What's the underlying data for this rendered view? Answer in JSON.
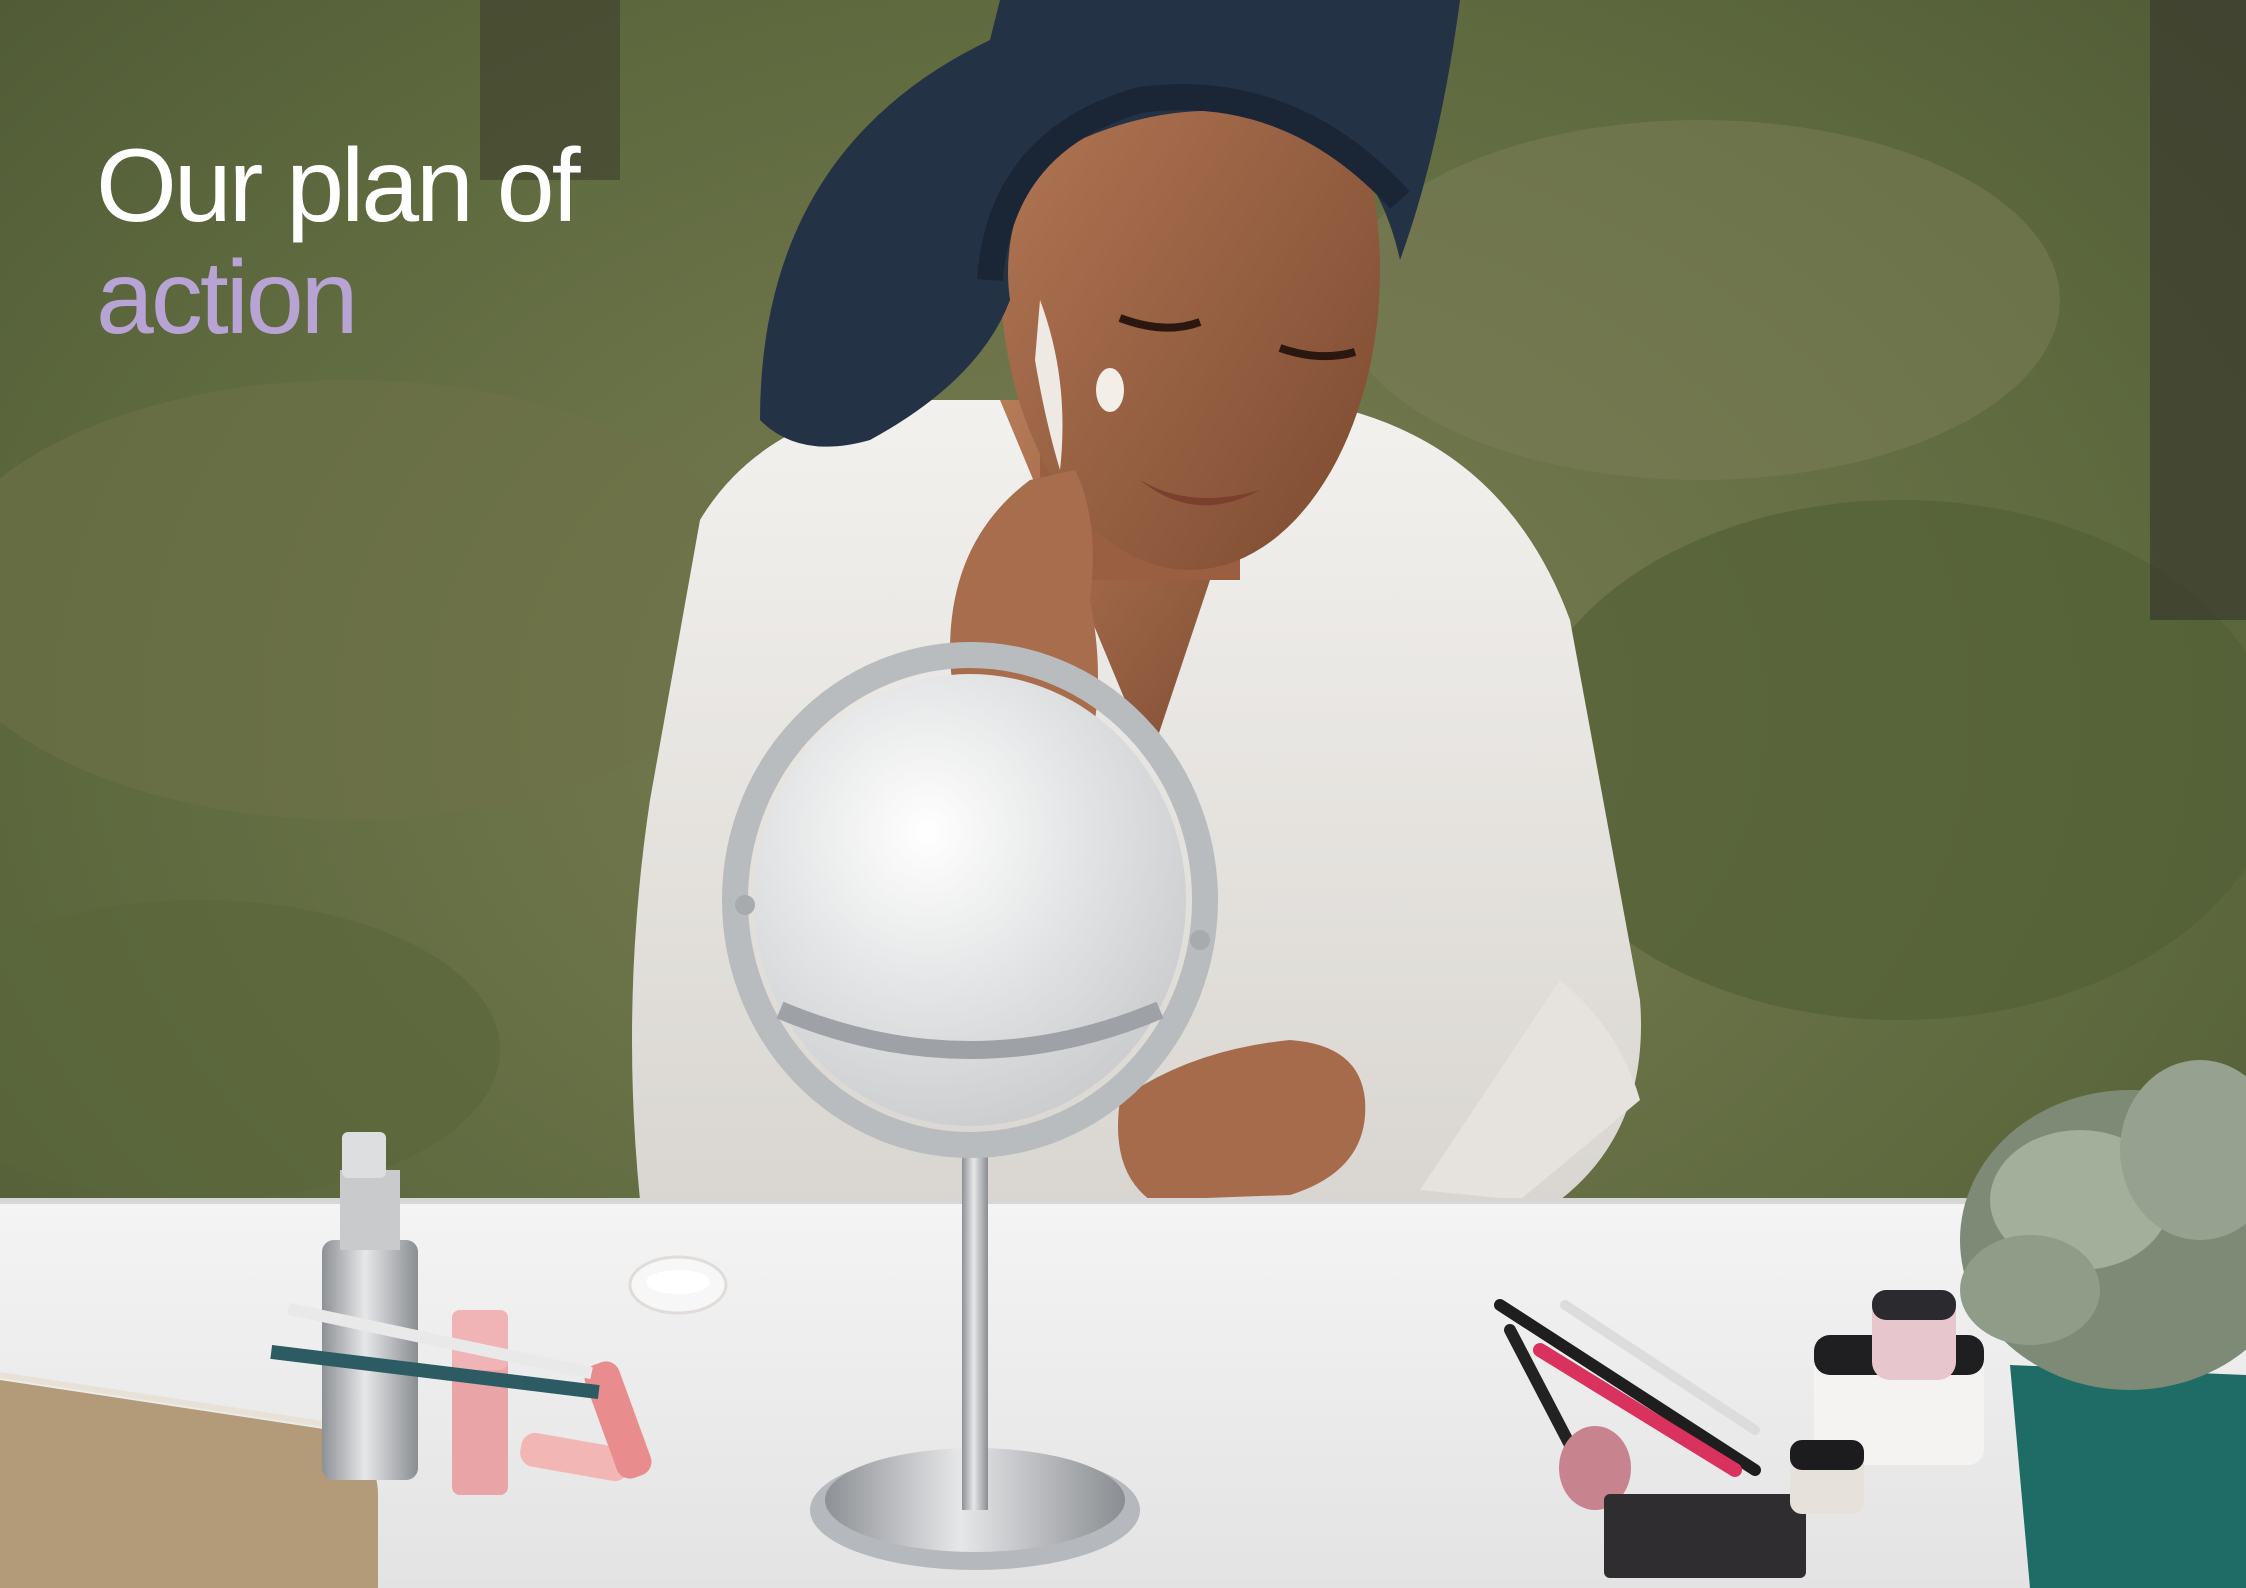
{
  "slide": {
    "headline": {
      "line1": "Our plan of",
      "line2": "action"
    },
    "colors": {
      "headline_primary": "#ffffff",
      "headline_accent": "#b7a4d4"
    },
    "photo": {
      "subject": "woman in white waffle robe and navy towel turban applying cream to her face at an outdoor vanity table with a round tabletop mirror, cosmetics, makeup brushes and a potted plant"
    }
  }
}
